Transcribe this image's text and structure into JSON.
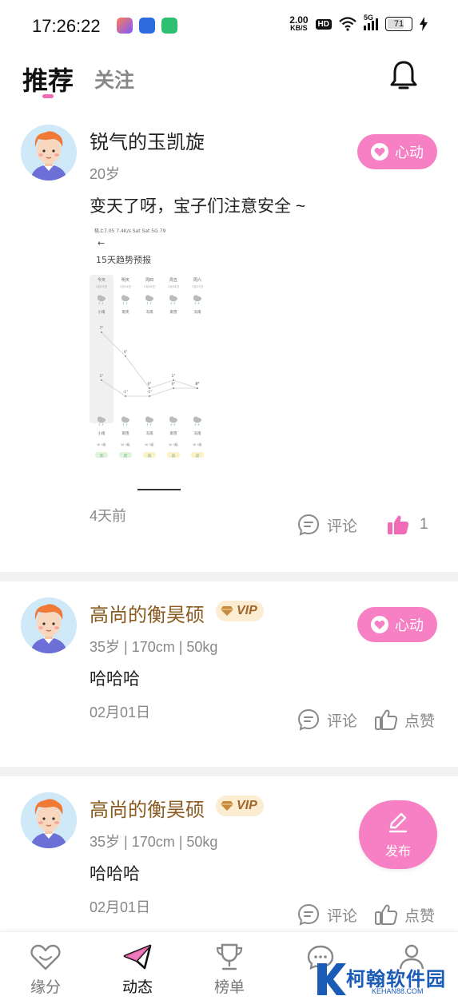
{
  "status_bar": {
    "time": "17:26:22",
    "net_speed": "2.00",
    "net_unit": "KB/S",
    "hd": "HD",
    "network": "5G",
    "battery": "71"
  },
  "tabs": {
    "recommend": "推荐",
    "follow": "关注"
  },
  "posts": [
    {
      "name": "锐气的玉凯旋",
      "vip": false,
      "meta": "20岁",
      "text": "变天了呀，宝子们注意安全 ~",
      "time": "4天前",
      "heart_label": "心动",
      "comment_label": "评论",
      "like_label": "1",
      "liked": true,
      "image": {
        "top_text": "极上7.05    7.4K/s  Sat Sat  5G  79",
        "back": "←",
        "title": "15天趋势预报",
        "days": [
          "今天",
          "明天",
          "周四",
          "周五",
          "周六"
        ],
        "dates": [
          "2月13日",
          "2月14日",
          "2月15日",
          "2月16日",
          "2月17日"
        ],
        "day_weather": [
          "小雨",
          "雨夹",
          "冻雨",
          "雨雪",
          "冻雨"
        ],
        "high_temps": [
          "7°",
          "4°",
          "0°",
          "1°",
          "0°"
        ],
        "low_temps": [
          "1°",
          "-1°",
          "-1°",
          "0°",
          "0°"
        ],
        "night_weather": [
          "小雨",
          "雨雪",
          "冻雨",
          "雨雪",
          "冻雨"
        ],
        "winds": [
          "W 3级",
          "W 3级",
          "W 3级",
          "W 3级",
          "W 3级"
        ],
        "aqi": [
          "优",
          "优",
          "良",
          "良",
          "良"
        ]
      }
    },
    {
      "name": "高尚的衡昊硕",
      "vip": true,
      "vip_label": "VIP",
      "meta": "35岁 | 170cm | 50kg",
      "text": "哈哈哈",
      "time": "02月01日",
      "heart_label": "心动",
      "comment_label": "评论",
      "like_label": "点赞"
    },
    {
      "name": "高尚的衡昊硕",
      "vip": true,
      "vip_label": "VIP",
      "meta": "35岁 | 170cm | 50kg",
      "text": "哈哈哈",
      "time": "02月01日",
      "comment_label": "评论",
      "like_label": "点赞"
    }
  ],
  "fab": {
    "label": "发布"
  },
  "bottom_nav": [
    {
      "label": "缘分",
      "icon": "heart-outline-icon"
    },
    {
      "label": "动态",
      "icon": "paper-plane-icon",
      "active": true
    },
    {
      "label": "榜单",
      "icon": "trophy-icon"
    },
    {
      "label": "",
      "icon": "chat-bubble-icon"
    },
    {
      "label": "",
      "icon": "person-icon"
    }
  ],
  "watermark": {
    "title": "柯翰软件园",
    "sub": "KEHAN88.COM"
  },
  "colors": {
    "accent_pink": "#f77fc3",
    "tab_indicator": "#f06cb6",
    "vip_gold": "#a0662a",
    "like_active": "#f06cb6"
  }
}
